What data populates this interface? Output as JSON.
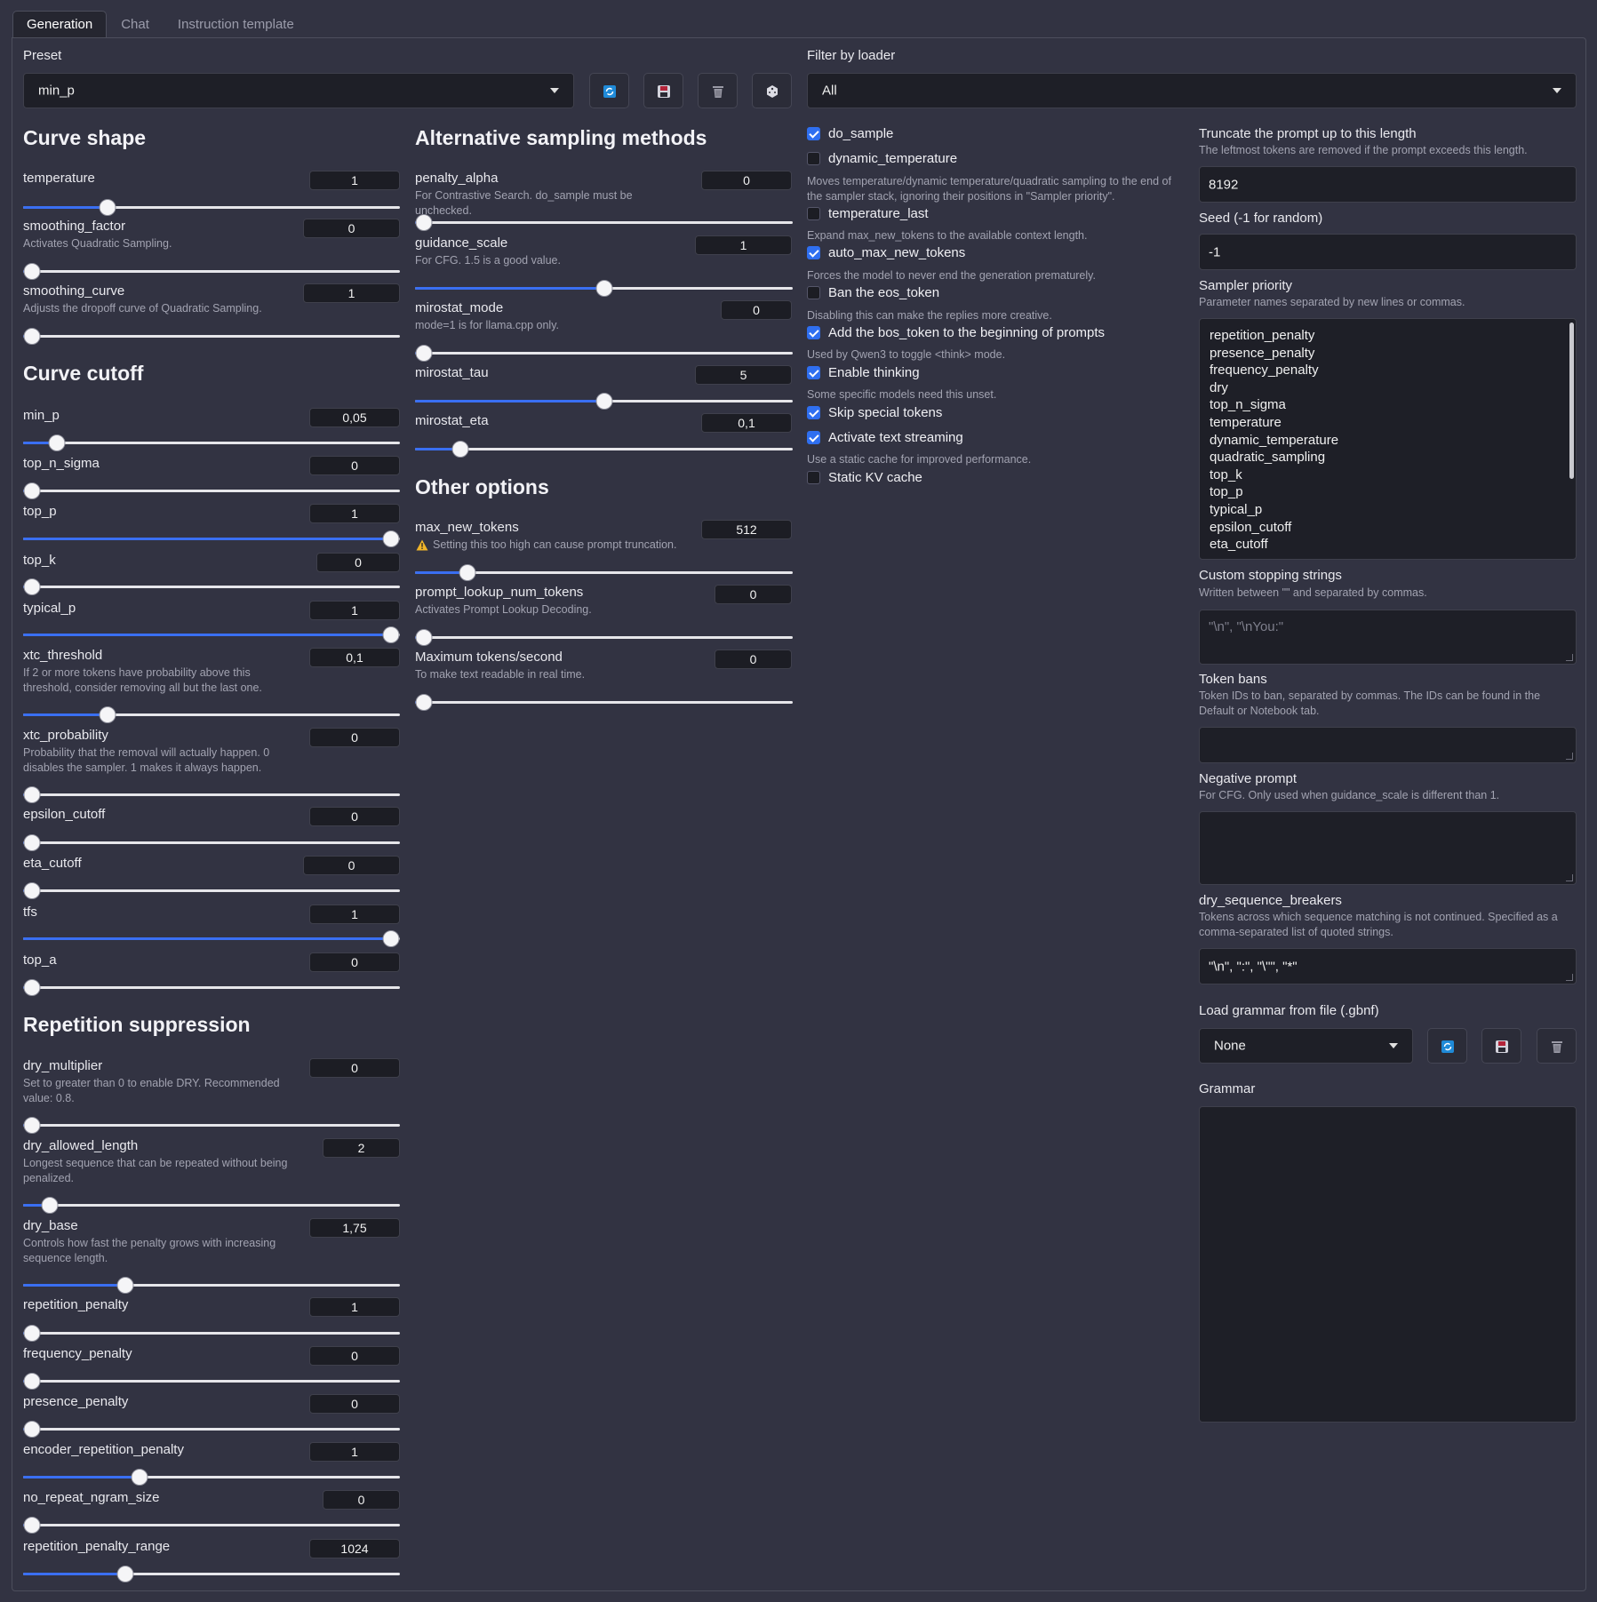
{
  "tabs": [
    {
      "label": "Generation"
    },
    {
      "label": "Chat"
    },
    {
      "label": "Instruction template"
    }
  ],
  "preset": {
    "label": "Preset",
    "value": "min_p"
  },
  "filter_loader": {
    "label": "Filter by loader",
    "value": "All"
  },
  "colors": {
    "background": "#323342",
    "accent": "#3a6ff2",
    "input_bg": "#1e1f27"
  },
  "sections": {
    "curve_shape": "Curve shape",
    "curve_cutoff": "Curve cutoff",
    "repetition_suppression": "Repetition suppression",
    "alternative_sampling": "Alternative sampling methods",
    "other_options": "Other options"
  },
  "params": {
    "temperature": {
      "label": "temperature",
      "value": "1",
      "level": 0.21
    },
    "smoothing_factor": {
      "label": "smoothing_factor",
      "desc": "Activates Quadratic Sampling.",
      "value": "0",
      "level": 0
    },
    "smoothing_curve": {
      "label": "smoothing_curve",
      "desc": "Adjusts the dropoff curve of Quadratic Sampling.",
      "value": "1",
      "level": 0
    },
    "min_p": {
      "label": "min_p",
      "value": "0,05",
      "level": 0.07
    },
    "top_n_sigma": {
      "label": "top_n_sigma",
      "value": "0",
      "level": 0
    },
    "top_p": {
      "label": "top_p",
      "value": "1",
      "level": 1
    },
    "top_k": {
      "label": "top_k",
      "value": "0",
      "level": 0
    },
    "typical_p": {
      "label": "typical_p",
      "value": "1",
      "level": 1
    },
    "xtc_threshold": {
      "label": "xtc_threshold",
      "desc": "If 2 or more tokens have probability above this threshold, consider removing all but the last one.",
      "value": "0,1",
      "level": 0.21
    },
    "xtc_probability": {
      "label": "xtc_probability",
      "desc": "Probability that the removal will actually happen. 0 disables the sampler. 1 makes it always happen.",
      "value": "0",
      "level": 0
    },
    "epsilon_cutoff": {
      "label": "epsilon_cutoff",
      "value": "0",
      "level": 0
    },
    "eta_cutoff": {
      "label": "eta_cutoff",
      "value": "0",
      "level": 0
    },
    "tfs": {
      "label": "tfs",
      "value": "1",
      "level": 1
    },
    "top_a": {
      "label": "top_a",
      "value": "0",
      "level": 0
    },
    "dry_multiplier": {
      "label": "dry_multiplier",
      "desc": "Set to greater than 0 to enable DRY. Recommended value: 0.8.",
      "value": "0",
      "level": 0
    },
    "dry_allowed_length": {
      "label": "dry_allowed_length",
      "desc": "Longest sequence that can be repeated without being penalized.",
      "value": "2",
      "level": 0.05
    },
    "dry_base": {
      "label": "dry_base",
      "desc": "Controls how fast the penalty grows with increasing sequence length.",
      "value": "1,75",
      "level": 0.26
    },
    "repetition_penalty": {
      "label": "repetition_penalty",
      "value": "1",
      "level": 0
    },
    "frequency_penalty": {
      "label": "frequency_penalty",
      "value": "0",
      "level": 0
    },
    "presence_penalty": {
      "label": "presence_penalty",
      "value": "0",
      "level": 0
    },
    "encoder_repetition_penalty": {
      "label": "encoder_repetition_penalty",
      "value": "1",
      "level": 0.3
    },
    "no_repeat_ngram_size": {
      "label": "no_repeat_ngram_size",
      "value": "0",
      "level": 0
    },
    "repetition_penalty_range": {
      "label": "repetition_penalty_range",
      "value": "1024",
      "level": 0.26
    },
    "penalty_alpha": {
      "label": "penalty_alpha",
      "desc": "For Contrastive Search. do_sample must be unchecked.",
      "value": "0",
      "level": 0
    },
    "guidance_scale": {
      "label": "guidance_scale",
      "desc": "For CFG. 1.5 is a good value.",
      "value": "1",
      "level": 0.5
    },
    "mirostat_mode": {
      "label": "mirostat_mode",
      "desc": "mode=1 is for llama.cpp only.",
      "value": "0",
      "level": 0
    },
    "mirostat_tau": {
      "label": "mirostat_tau",
      "value": "5",
      "level": 0.5
    },
    "mirostat_eta": {
      "label": "mirostat_eta",
      "value": "0,1",
      "level": 0.1
    },
    "max_new_tokens": {
      "label": "max_new_tokens",
      "desc": "Setting this too high can cause prompt truncation.",
      "value": "512",
      "level": 0.12
    },
    "prompt_lookup_num_tokens": {
      "label": "prompt_lookup_num_tokens",
      "desc": "Activates Prompt Lookup Decoding.",
      "value": "0",
      "level": 0
    },
    "maximum_tokens_second": {
      "label": "Maximum tokens/second",
      "desc": "To make text readable in real time.",
      "value": "0",
      "level": 0
    }
  },
  "checkboxes": {
    "do_sample": {
      "label": "do_sample",
      "checked": true
    },
    "dynamic_temperature": {
      "label": "dynamic_temperature",
      "checked": false
    },
    "temperature_last": {
      "label": "temperature_last",
      "desc": "Moves temperature/dynamic temperature/quadratic sampling to the end of the sampler stack, ignoring their positions in \"Sampler priority\".",
      "checked": false
    },
    "auto_max_new_tokens": {
      "label": "auto_max_new_tokens",
      "desc": "Expand max_new_tokens to the available context length.",
      "checked": true
    },
    "ban_eos": {
      "label": "Ban the eos_token",
      "desc": "Forces the model to never end the generation prematurely.",
      "checked": false
    },
    "add_bos": {
      "label": "Add the bos_token to the beginning of prompts",
      "desc": "Disabling this can make the replies more creative.",
      "checked": true
    },
    "enable_thinking": {
      "label": "Enable thinking",
      "desc": "Used by Qwen3 to toggle <think> mode.",
      "checked": true
    },
    "skip_special": {
      "label": "Skip special tokens",
      "desc": "Some specific models need this unset.",
      "checked": true
    },
    "text_streaming": {
      "label": "Activate text streaming",
      "checked": true
    },
    "static_kv": {
      "label": "Static KV cache",
      "desc": "Use a static cache for improved performance.",
      "checked": false
    }
  },
  "right": {
    "truncate": {
      "label": "Truncate the prompt up to this length",
      "desc": "The leftmost tokens are removed if the prompt exceeds this length.",
      "value": "8192"
    },
    "seed": {
      "label": "Seed (-1 for random)",
      "value": "-1"
    },
    "sampler_priority": {
      "label": "Sampler priority",
      "desc": "Parameter names separated by new lines or commas.",
      "items": [
        "repetition_penalty",
        "presence_penalty",
        "frequency_penalty",
        "dry",
        "top_n_sigma",
        "temperature",
        "dynamic_temperature",
        "quadratic_sampling",
        "top_k",
        "top_p",
        "typical_p",
        "epsilon_cutoff",
        "eta_cutoff"
      ]
    },
    "stopping": {
      "label": "Custom stopping strings",
      "desc": "Written between \"\" and separated by commas.",
      "placeholder": "\"\\n\", \"\\nYou:\""
    },
    "token_bans": {
      "label": "Token bans",
      "desc": "Token IDs to ban, separated by commas. The IDs can be found in the Default or Notebook tab."
    },
    "negative_prompt": {
      "label": "Negative prompt",
      "desc": "For CFG. Only used when guidance_scale is different than 1."
    },
    "dry_breakers": {
      "label": "dry_sequence_breakers",
      "desc": "Tokens across which sequence matching is not continued. Specified as a comma-separated list of quoted strings.",
      "value": "\"\\n\", \":\", \"\\\"\", \"*\""
    },
    "grammar_file": {
      "label": "Load grammar from file (.gbnf)",
      "value": "None"
    },
    "grammar": {
      "label": "Grammar"
    }
  }
}
